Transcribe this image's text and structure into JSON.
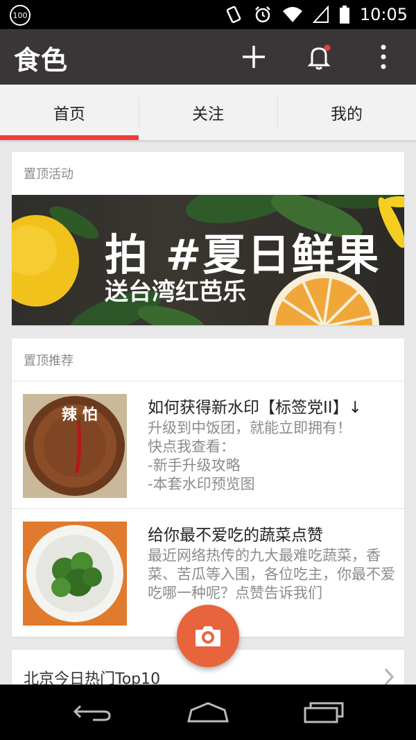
{
  "status": {
    "badge": "100",
    "time": "10:05"
  },
  "app_bar": {
    "title": "食色",
    "add_icon": "plus-icon",
    "bell_icon": "bell-icon",
    "more_icon": "more-vert-icon",
    "notification_dot_color": "#f23c3c"
  },
  "tabs": [
    {
      "label": "首页",
      "active": true
    },
    {
      "label": "关注",
      "active": false
    },
    {
      "label": "我的",
      "active": false
    }
  ],
  "accent_color": "#f23c3c",
  "pinned_activity": {
    "header": "置顶活动",
    "banner_title": "拍 #夏日鲜果",
    "banner_subtitle": "送台湾红芭乐"
  },
  "pinned_recommend": {
    "header": "置顶推荐",
    "items": [
      {
        "title": "如何获得新水印【标签党II】↓",
        "body": "升级到中饭团，就能立即拥有！\n快点我查看：\n-新手升级攻略\n-本套水印预览图",
        "thumb_text": "辣 怕"
      },
      {
        "title": "给你最不爱吃的蔬菜点赞",
        "body": "最近网络热传的九大最难吃蔬菜，香菜、苦瓜等入围，各位吃主，你最不爱吃哪一种呢？点赞告诉我们"
      }
    ]
  },
  "hot_list": {
    "title": "北京今日热门Top10"
  },
  "fab": {
    "icon": "camera-icon",
    "color": "#e8643c"
  },
  "nav": {
    "back_icon": "back-icon",
    "home_icon": "home-icon",
    "recent_icon": "recent-apps-icon"
  }
}
